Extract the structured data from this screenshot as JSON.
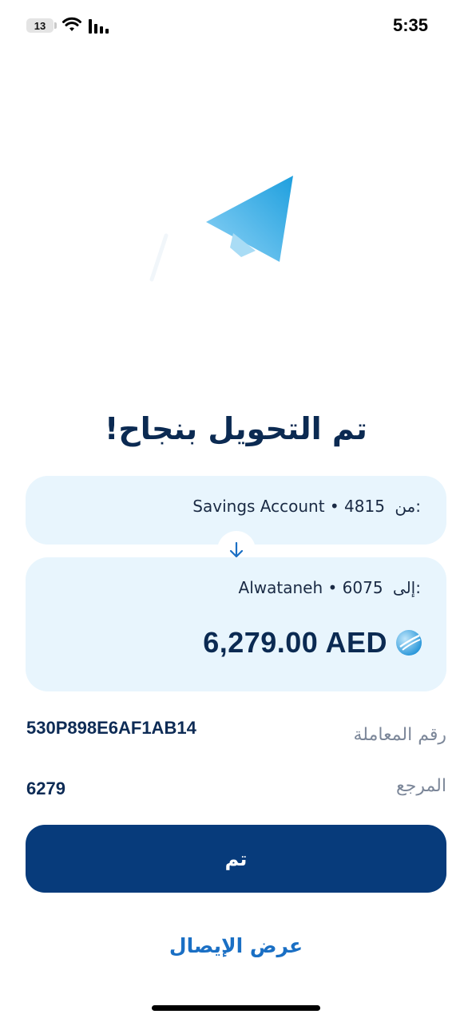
{
  "status_bar": {
    "battery_level": "13",
    "time": "5:35"
  },
  "title": "تم التحويل بنجاح!",
  "from": {
    "label": "من:",
    "account": "Savings Account • 4815"
  },
  "to": {
    "label": "إلى:",
    "account": "Alwataneh • 6075"
  },
  "amount": "6,279.00 AED",
  "details": {
    "transaction_label": "رقم المعاملة",
    "transaction_value": "530P898E6AF1AB14",
    "reference_label": "المرجع",
    "reference_value": "6279"
  },
  "buttons": {
    "done_label": "تم",
    "receipt_label": "عرض الإيصال"
  },
  "colors": {
    "primary": "#073b7b",
    "card_bg": "#e8f5fd",
    "link": "#1a6fc4"
  }
}
